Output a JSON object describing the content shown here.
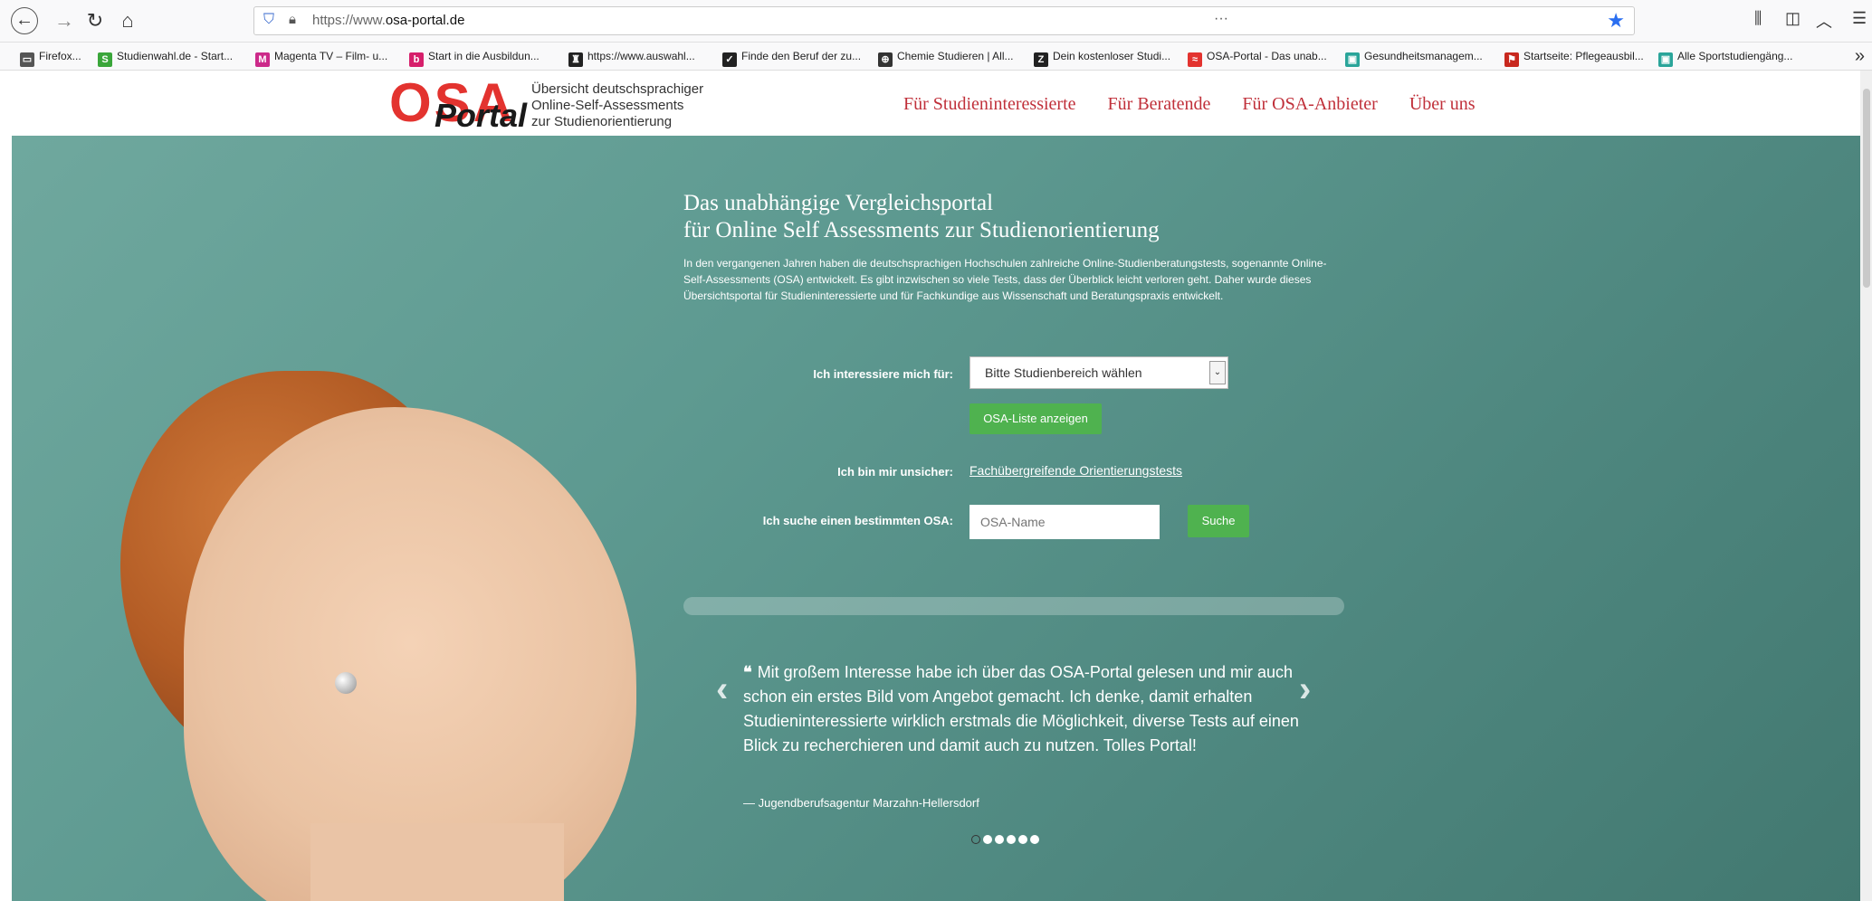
{
  "browser": {
    "url_prefix": "https://www.",
    "url_domain": "osa-portal.de",
    "overflow_label": "···"
  },
  "bookmarks": [
    {
      "label": "Firefox...",
      "icon": "folder-icon",
      "color": "#555555"
    },
    {
      "label": "Studienwahl.de - Start...",
      "icon": "s-icon",
      "color": "#3aa63a"
    },
    {
      "label": "Magenta TV – Film- u...",
      "icon": "m-icon",
      "color": "#cc2a8a"
    },
    {
      "label": "Start in die Ausbildun...",
      "icon": "b-icon",
      "color": "#d61f6b"
    },
    {
      "label": "https://www.auswahl...",
      "icon": "person-icon",
      "color": "#222222"
    },
    {
      "label": "Finde den Beruf der zu...",
      "icon": "swoosh-icon",
      "color": "#222222"
    },
    {
      "label": "Chemie Studieren | All...",
      "icon": "globe-icon",
      "color": "#333333"
    },
    {
      "label": "Dein kostenloser Studi...",
      "icon": "z-icon",
      "color": "#222222"
    },
    {
      "label": "OSA-Portal - Das unab...",
      "icon": "osa-icon",
      "color": "#e3332f"
    },
    {
      "label": "Gesundheitsmanagem...",
      "icon": "health-icon",
      "color": "#2aa59a"
    },
    {
      "label": "Startseite: Pflegeausbil...",
      "icon": "flag-icon",
      "color": "#c8281e"
    },
    {
      "label": "Alle Sportstudiengäng...",
      "icon": "sport-icon",
      "color": "#2aa59a"
    }
  ],
  "header": {
    "logo_osa": "OSA",
    "logo_portal": "Portal",
    "tagline_1": "Übersicht deutschsprachiger",
    "tagline_2": "Online-Self-Assessments",
    "tagline_3": "zur Studienorientierung",
    "nav": [
      "Für Studieninteressierte",
      "Für Beratende",
      "Für OSA-Anbieter",
      "Über uns"
    ]
  },
  "hero": {
    "title_1": "Das unabhängige Vergleichsportal",
    "title_2": "für Online Self Assessments zur Studienorientierung",
    "text": "In den vergangenen Jahren haben die deutschsprachigen Hochschulen zahlreiche Online-Studienberatungstests, sogenannte Online-Self-Assessments (OSA) entwickelt. Es gibt inzwischen so viele Tests, dass der Überblick leicht verloren geht. Daher wurde dieses Übersichtsportal für Studieninteressierte und für Fachkundige aus Wissenschaft und Beratungspraxis entwickelt.",
    "label_interest": "Ich interessiere mich für:",
    "select_value": "Bitte Studienbereich wählen",
    "show_list_button": "OSA-Liste anzeigen",
    "label_unsure": "Ich bin mir unsicher:",
    "unsure_link": "Fachübergreifende Orientierungstests",
    "label_search": "Ich suche einen bestimmten OSA:",
    "search_placeholder": "OSA-Name",
    "search_button": "Suche"
  },
  "testimonial": {
    "quote": "Mit großem Interesse habe ich über das OSA-Portal gelesen und mir auch schon ein erstes Bild vom Angebot gemacht. Ich denke, damit erhalten Studieninteressierte wirklich erstmals die Möglichkeit, diverse Tests auf einen Blick zu recherchieren und damit auch zu nutzen. Tolles Portal!",
    "source": "— Jugendberufsagentur Marzahn-Hellersdorf",
    "slide_count": 6,
    "active_slide": 1
  }
}
